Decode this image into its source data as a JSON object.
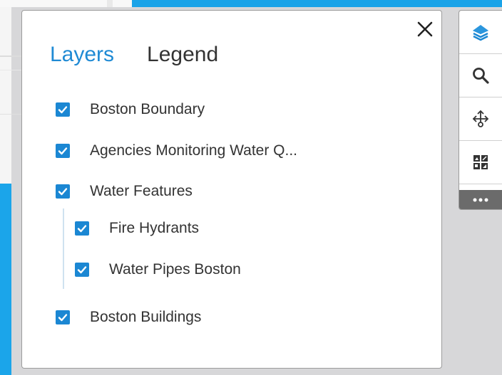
{
  "colors": {
    "accent": "#1f8ad4",
    "checkbox": "#1b87d3",
    "text": "#333333",
    "map_blue": "#1aa3e8"
  },
  "panel": {
    "tabs": [
      {
        "label": "Layers",
        "active": true
      },
      {
        "label": "Legend",
        "active": false
      }
    ],
    "close_icon": "close-icon",
    "layers": [
      {
        "label": "Boston Boundary",
        "checked": true,
        "level": 0
      },
      {
        "label": "Agencies Monitoring Water Q...",
        "checked": true,
        "level": 0
      },
      {
        "label": "Water Features",
        "checked": true,
        "level": 0
      },
      {
        "label": "Fire Hydrants",
        "checked": true,
        "level": 1
      },
      {
        "label": "Water Pipes Boston",
        "checked": true,
        "level": 1
      },
      {
        "label": "Boston Buildings",
        "checked": true,
        "level": 0
      }
    ]
  },
  "toolbar": {
    "tools": [
      {
        "icon": "layers-icon"
      },
      {
        "icon": "search-icon"
      },
      {
        "icon": "pan-move-icon"
      },
      {
        "icon": "basemap-gallery-icon"
      }
    ],
    "more_icon": "more-icon"
  }
}
